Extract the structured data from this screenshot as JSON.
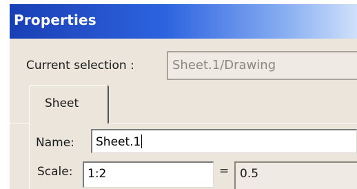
{
  "window": {
    "title": "Properties"
  },
  "selection": {
    "label": "Current selection :",
    "value": "Sheet.1/Drawing"
  },
  "tabs": [
    {
      "label": "Sheet",
      "active": true
    }
  ],
  "sheet": {
    "name_label": "Name:",
    "name_value": "Sheet.1",
    "scale_label": "Scale:",
    "scale_value": "1:2",
    "equals": "=",
    "scale_decimal": "0.5"
  },
  "colors": {
    "title_bar": "#2d63e0",
    "dialog_background": "#ece5dc"
  }
}
